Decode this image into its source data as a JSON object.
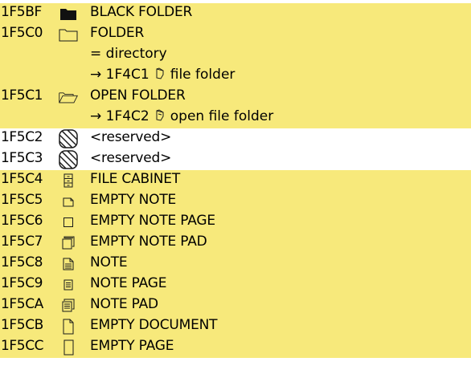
{
  "colors": {
    "highlight": "#f7e97b",
    "plain": "#ffffff",
    "glyph_stroke": "#1a1a1a"
  },
  "entries": [
    {
      "code": "1F5BF",
      "name": "BLACK FOLDER",
      "icon": "black-folder-icon",
      "highlighted": true,
      "notes": []
    },
    {
      "code": "1F5C0",
      "name": "FOLDER",
      "icon": "folder-icon",
      "highlighted": true,
      "notes": [
        {
          "type": "alias",
          "text": "= directory"
        },
        {
          "type": "xref",
          "prefix": "→ 1F4C1",
          "icon": "file-folder-icon",
          "name": "file folder"
        }
      ]
    },
    {
      "code": "1F5C1",
      "name": "OPEN FOLDER",
      "icon": "open-folder-icon",
      "highlighted": true,
      "notes": [
        {
          "type": "xref",
          "prefix": "→ 1F4C2",
          "icon": "open-file-folder-icon",
          "name": "open file folder"
        }
      ]
    },
    {
      "code": "1F5C2",
      "name": "<reserved>",
      "icon": "reserved-hatched-icon",
      "highlighted": false,
      "notes": []
    },
    {
      "code": "1F5C3",
      "name": "<reserved>",
      "icon": "reserved-hatched-icon",
      "highlighted": false,
      "notes": []
    },
    {
      "code": "1F5C4",
      "name": "FILE CABINET",
      "icon": "file-cabinet-icon",
      "highlighted": true,
      "notes": []
    },
    {
      "code": "1F5C5",
      "name": "EMPTY NOTE",
      "icon": "empty-note-icon",
      "highlighted": true,
      "notes": []
    },
    {
      "code": "1F5C6",
      "name": "EMPTY NOTE PAGE",
      "icon": "empty-note-page-icon",
      "highlighted": true,
      "notes": []
    },
    {
      "code": "1F5C7",
      "name": "EMPTY NOTE PAD",
      "icon": "empty-note-pad-icon",
      "highlighted": true,
      "notes": []
    },
    {
      "code": "1F5C8",
      "name": "NOTE",
      "icon": "note-icon",
      "highlighted": true,
      "notes": []
    },
    {
      "code": "1F5C9",
      "name": "NOTE PAGE",
      "icon": "note-page-icon",
      "highlighted": true,
      "notes": []
    },
    {
      "code": "1F5CA",
      "name": "NOTE PAD",
      "icon": "note-pad-icon",
      "highlighted": true,
      "notes": []
    },
    {
      "code": "1F5CB",
      "name": "EMPTY DOCUMENT",
      "icon": "empty-document-icon",
      "highlighted": true,
      "notes": []
    },
    {
      "code": "1F5CC",
      "name": "EMPTY PAGE",
      "icon": "empty-page-icon",
      "highlighted": true,
      "notes": []
    }
  ]
}
